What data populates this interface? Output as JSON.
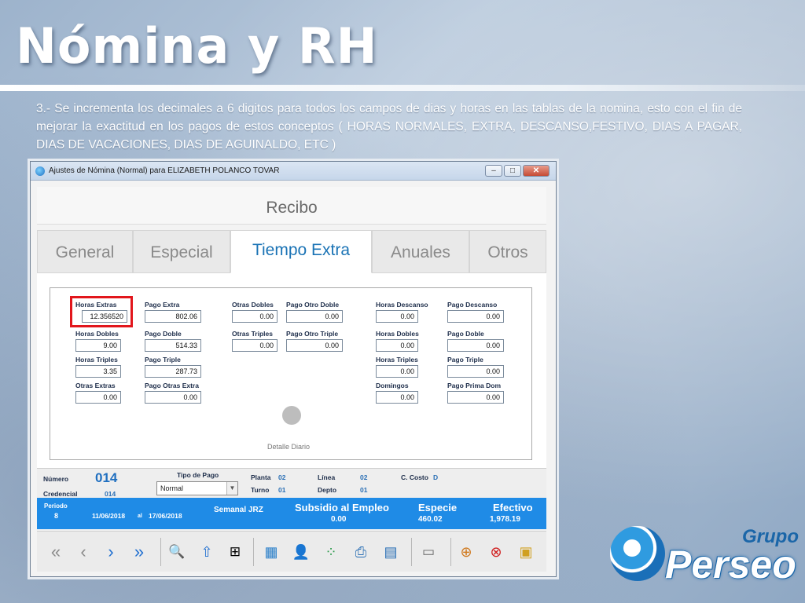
{
  "slide": {
    "title": "Nómina y RH",
    "description": "3.- Se incrementa los decimales a 6 digitos para todos los campos de dias y horas en las tablas de la nomina, esto con el fin de mejorar la exactitud en los pagos de estos conceptos ( HORAS NORMALES, EXTRA, DESCANSO,FESTIVO, DIAS A PAGAR, DIAS DE VACACIONES, DIAS DE AGUINALDO, ETC )"
  },
  "window": {
    "title": "Ajustes de Nómina (Normal) para ELIZABETH POLANCO TOVAR",
    "minimize": "–",
    "maximize": "□",
    "close": "✕"
  },
  "header": {
    "recibo": "Recibo"
  },
  "tabs": [
    {
      "label": "General"
    },
    {
      "label": "Especial"
    },
    {
      "label": "Tiempo Extra",
      "active": true
    },
    {
      "label": "Anuales"
    },
    {
      "label": "Otros"
    }
  ],
  "fields": {
    "horas_extras": {
      "label": "Horas Extras",
      "value": "12.356520"
    },
    "horas_dobles": {
      "label": "Horas Dobles",
      "value": "9.00"
    },
    "horas_triples": {
      "label": "Horas Triples",
      "value": "3.35"
    },
    "otras_extras": {
      "label": "Otras Extras",
      "value": "0.00"
    },
    "pago_extra": {
      "label": "Pago Extra",
      "value": "802.06"
    },
    "pago_doble": {
      "label": "Pago Doble",
      "value": "514.33"
    },
    "pago_triple": {
      "label": "Pago Triple",
      "value": "287.73"
    },
    "pago_otras_extra": {
      "label": "Pago Otras Extra",
      "value": "0.00"
    },
    "otras_dobles": {
      "label": "Otras Dobles",
      "value": "0.00"
    },
    "otras_triples": {
      "label": "Otras Triples",
      "value": "0.00"
    },
    "pago_otro_doble": {
      "label": "Pago Otro Doble",
      "value": "0.00"
    },
    "pago_otro_triple": {
      "label": "Pago Otro Triple",
      "value": "0.00"
    },
    "horas_descanso": {
      "label": "Horas Descanso",
      "value": "0.00"
    },
    "horas_dobles_2": {
      "label": "Horas Dobles",
      "value": "0.00"
    },
    "horas_triples_2": {
      "label": "Horas Triples",
      "value": "0.00"
    },
    "domingos": {
      "label": "Domingos",
      "value": "0.00"
    },
    "pago_descanso": {
      "label": "Pago Descanso",
      "value": "0.00"
    },
    "pago_doble_2": {
      "label": "Pago Doble",
      "value": "0.00"
    },
    "pago_triple_2": {
      "label": "Pago Triple",
      "value": "0.00"
    },
    "pago_prima_dom": {
      "label": "Pago Prima Dom",
      "value": "0.00"
    }
  },
  "detalle_diario": "Detalle Diario",
  "employee": {
    "numero_label": "Número",
    "numero_value": "014",
    "credencial_label": "Credencial",
    "credencial_value": "014",
    "tipo_pago_label": "Tipo de Pago",
    "tipo_pago_value": "Normal",
    "planta_label": "Planta",
    "planta_value": "02",
    "turno_label": "Turno",
    "turno_value": "01",
    "linea_label": "Línea",
    "linea_value": "02",
    "depto_label": "Depto",
    "depto_value": "01",
    "ccosto_label": "C. Costo",
    "ccosto_value": "D"
  },
  "period": {
    "periodo_label": "Periodo",
    "periodo_value": "8",
    "fecha_inicio": "11/06/2018",
    "al": "al",
    "fecha_fin": "17/06/2018",
    "semanal": "Semanal JRZ",
    "subsidio_label": "Subsidio al Empleo",
    "subsidio_value": "0.00",
    "especie_label": "Especie",
    "especie_value": "460.02",
    "efectivo_label": "Efectivo",
    "efectivo_value": "1,978.19"
  },
  "toolbar_icons": [
    "first-icon",
    "prev-icon",
    "next-icon",
    "last-icon",
    "search-icon",
    "upload-icon",
    "zoom-grid-icon",
    "calculator-icon",
    "user-icon",
    "dots-grid-icon",
    "print-check-icon",
    "calendar-icon",
    "document-icon",
    "add-row-icon",
    "delete-row-icon",
    "package-icon"
  ],
  "logo": {
    "grupo": "Grupo",
    "perseo": "Perseo"
  },
  "colors": {
    "accent_blue": "#1f8be6",
    "highlight_red": "#e2161c",
    "active_tab": "#1a73b5"
  }
}
